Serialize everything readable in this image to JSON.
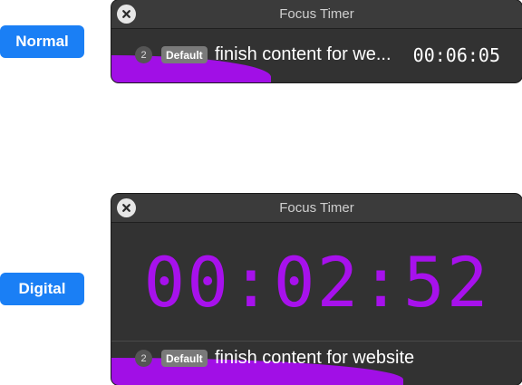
{
  "modes": [
    {
      "label": "Normal",
      "window": {
        "title": "Focus Timer",
        "task": {
          "count": "2",
          "list": "Default",
          "text": "finish content for we...",
          "time": "00:06:05"
        }
      }
    },
    {
      "label": "Digital",
      "window": {
        "title": "Focus Timer",
        "digital_time": "00:02:52",
        "task": {
          "count": "2",
          "list": "Default",
          "text": "finish content for website"
        }
      }
    }
  ],
  "colors": {
    "accent": "#a711ec",
    "label_bg": "#1a7ff5",
    "window_bg": "#323232"
  },
  "icons": {
    "close": "close-icon"
  }
}
